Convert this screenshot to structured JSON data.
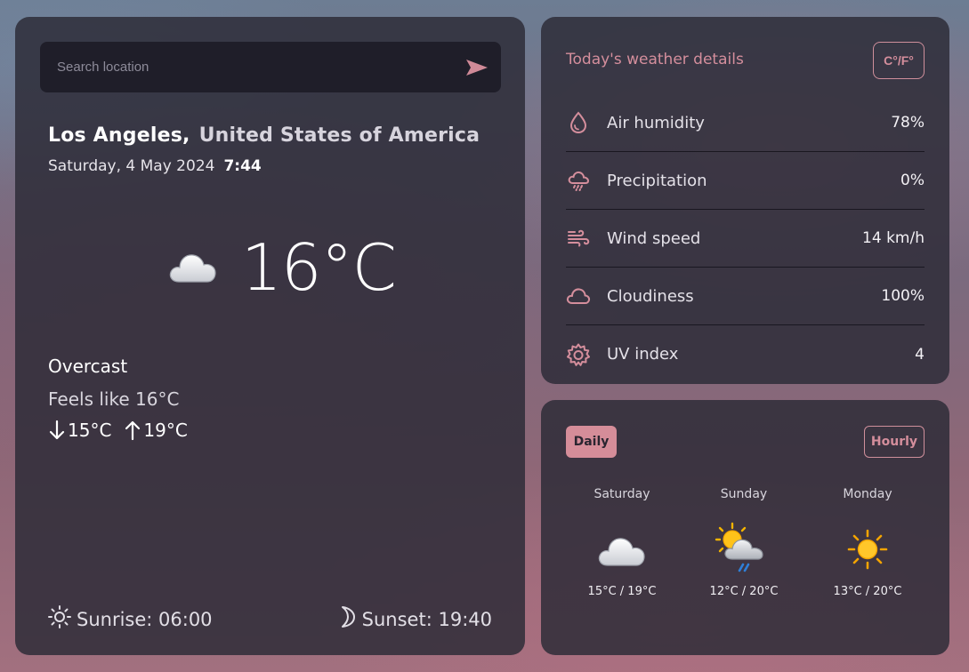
{
  "search": {
    "placeholder": "Search location"
  },
  "location": {
    "city": "Los Angeles,",
    "country": "United States of America"
  },
  "datetime": {
    "date": "Saturday, 4 May 2024",
    "time": "7:44"
  },
  "current": {
    "temperature": "16°C",
    "icon": "cloud-icon",
    "condition": "Overcast",
    "feels_like": "Feels like 16°C",
    "min": "15°C",
    "max": "19°C"
  },
  "sun": {
    "sunrise": "Sunrise: 06:00",
    "sunset": "Sunset: 19:40"
  },
  "details": {
    "title": "Today's weather details",
    "unit_toggle": "C°/F°",
    "rows": [
      {
        "label": "Air humidity",
        "value": "78%",
        "icon": "droplet-icon"
      },
      {
        "label": "Precipitation",
        "value": "0%",
        "icon": "rain-cloud-icon"
      },
      {
        "label": "Wind speed",
        "value": "14 km/h",
        "icon": "wind-icon"
      },
      {
        "label": "Cloudiness",
        "value": "100%",
        "icon": "cloud-icon"
      },
      {
        "label": "UV index",
        "value": "4",
        "icon": "sun-gear-icon"
      }
    ]
  },
  "forecast": {
    "tabs": {
      "daily": "Daily",
      "hourly": "Hourly"
    },
    "days": [
      {
        "name": "Saturday",
        "range": "15°C / 19°C",
        "icon": "cloud-icon"
      },
      {
        "name": "Sunday",
        "range": "12°C / 20°C",
        "icon": "sun-cloud-rain-icon"
      },
      {
        "name": "Monday",
        "range": "13°C / 20°C",
        "icon": "sun-icon"
      }
    ]
  },
  "colors": {
    "accent": "#d48e9c",
    "panel": "#2c2b37",
    "search_bg": "#1f1e29"
  }
}
